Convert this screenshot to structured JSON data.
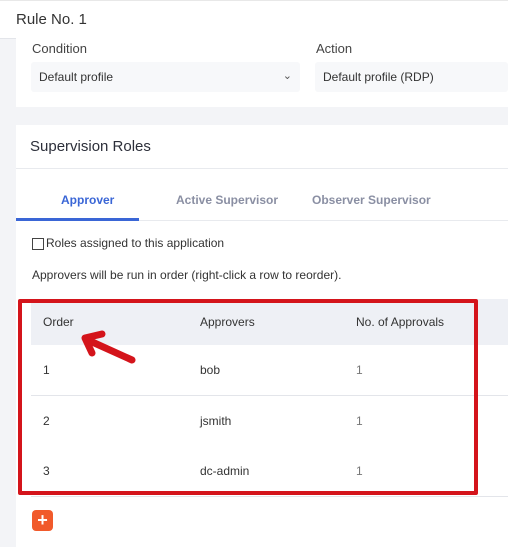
{
  "header": {
    "title": "Rule No. 1"
  },
  "rule": {
    "condition_label": "Condition",
    "condition_value": "Default profile",
    "action_label": "Action",
    "action_value": "Default profile (RDP)"
  },
  "supervision": {
    "title": "Supervision Roles",
    "tabs": [
      {
        "label": "Approver",
        "active": true
      },
      {
        "label": "Active Supervisor",
        "active": false
      },
      {
        "label": "Observer Supervisor",
        "active": false
      }
    ],
    "checkbox_label": "Roles assigned to this application",
    "checkbox_checked": false,
    "info": "Approvers will be run in order (right-click a row to reorder).",
    "table": {
      "columns": [
        "Order",
        "Approvers",
        "No. of Approvals"
      ],
      "rows": [
        {
          "order": "1",
          "approver": "bob",
          "approvals": "1"
        },
        {
          "order": "2",
          "approver": "jsmith",
          "approvals": "1"
        },
        {
          "order": "3",
          "approver": "dc-admin",
          "approvals": "1"
        }
      ]
    },
    "add_label": "+"
  },
  "colors": {
    "accent": "#3a66d6",
    "highlight": "#d4141b",
    "add_button": "#f15a2b"
  },
  "icons": {
    "chevron": "chevron-down-icon",
    "add": "plus-icon",
    "arrow": "red-arrow-annotation"
  }
}
